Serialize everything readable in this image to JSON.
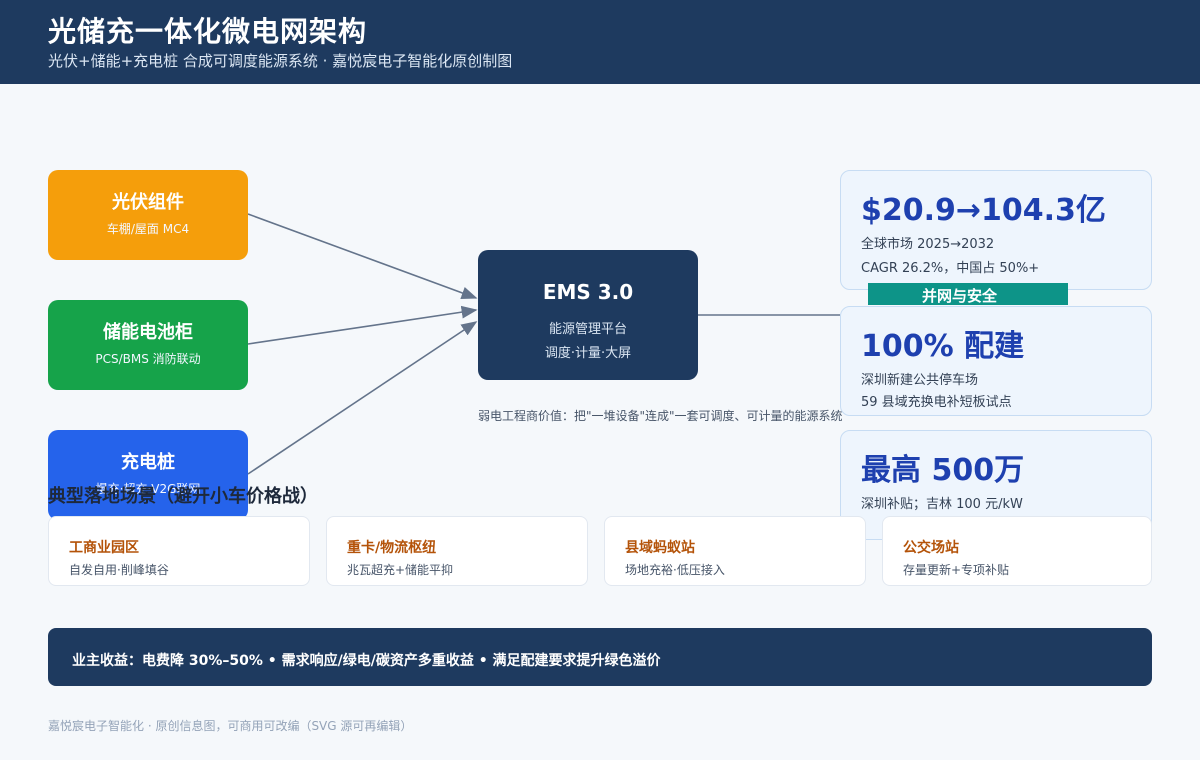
{
  "header": {
    "title": "光储充一体化微电网架构",
    "subtitle": "光伏+储能+充电桩 合成可调度能源系统 · 嘉悦宸电子智能化原创制图"
  },
  "sources": [
    {
      "name": "光伏组件",
      "desc": "车棚/屋面 MC4",
      "color": "#f59e0b"
    },
    {
      "name": "储能电池柜",
      "desc": "PCS/BMS 消防联动",
      "color": "#16a34a"
    },
    {
      "name": "充电桩",
      "desc": "慢充·超充·V2G联网",
      "color": "#2563eb"
    }
  ],
  "ems": {
    "name": "EMS 3.0",
    "line1": "能源管理平台",
    "line2": "调度·计量·大屏"
  },
  "note": "弱电工程商价值：把\"一堆设备\"连成\"一套可调度、可计量的能源系统",
  "stats": [
    {
      "big": "$20.9→104.3亿",
      "line1": "全球市场 2025→2032",
      "line2": "CAGR 26.2%，中国占 50%+"
    },
    {
      "big": "100% 配建",
      "line1": "深圳新建公共停车场",
      "line2": "59 县域充换电补短板试点"
    },
    {
      "big": "最高 500万",
      "line1": "深圳补贴；吉林 100 元/kW",
      "line2": ""
    }
  ],
  "teal_label": "并网与安全",
  "scenes_title": "典型落地场景（避开小车价格战）",
  "scenes": [
    {
      "title": "工商业园区",
      "desc": "自发自用·削峰填谷"
    },
    {
      "title": "重卡/物流枢纽",
      "desc": "兆瓦超充+储能平抑"
    },
    {
      "title": "县域蚂蚁站",
      "desc": "场地充裕·低压接入"
    },
    {
      "title": "公交场站",
      "desc": "存量更新+专项补贴"
    }
  ],
  "banner": "业主收益：电费降 30%–50% • 需求响应/绿电/碳资产多重收益 • 满足配建要求提升绿色溢价",
  "footer": "嘉悦宸电子智能化 · 原创信息图，可商用可改编（SVG 源可再编辑）",
  "colors": {
    "header_bg": "#1e3a5f",
    "accent": "#1e40af",
    "scene_title": "#b45309",
    "teal": "#0d9488"
  }
}
